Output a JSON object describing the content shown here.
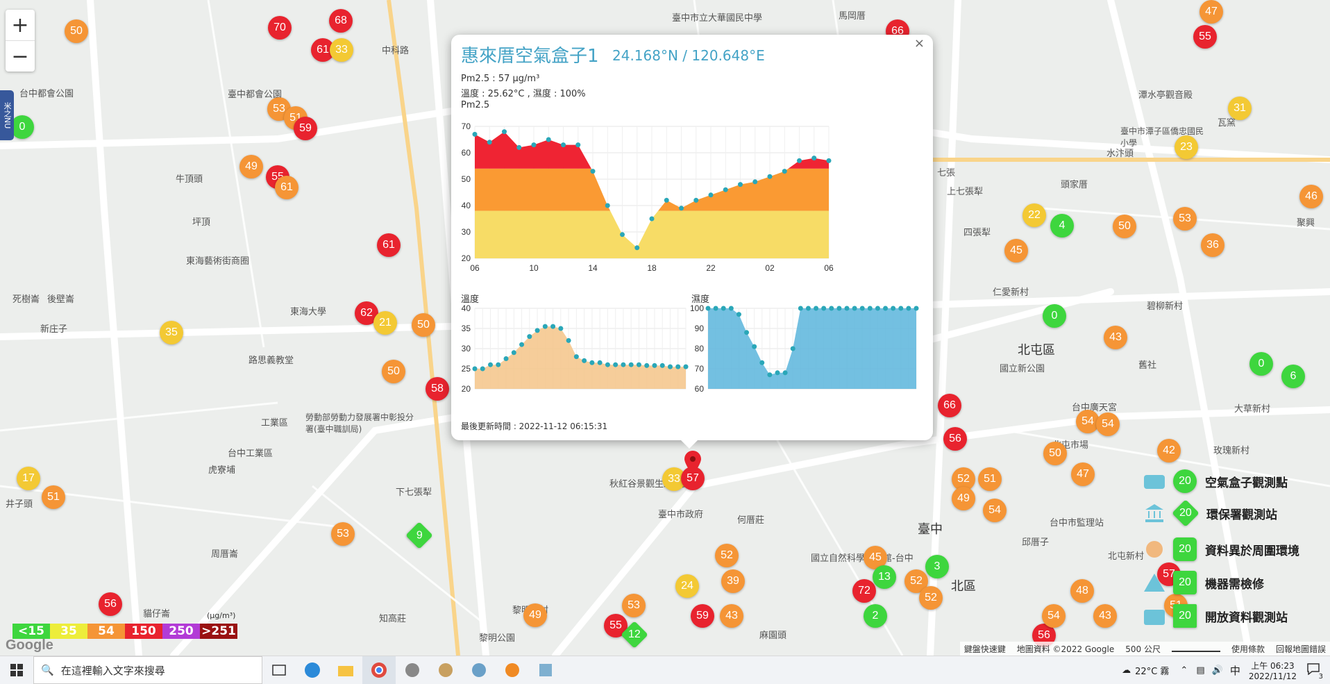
{
  "map": {
    "zoom_in": "+",
    "zoom_out": "−",
    "side_tab": "米之NU",
    "places": [
      "牛頂頭",
      "坪頂",
      "死樹崙",
      "後壁崙",
      "新庄子",
      "臺中都會公園",
      "東海藝術街商圈",
      "東海大學",
      "路思義教堂",
      "勞動部勞動力發展署中彰投分署(臺中職訓局)",
      "工業區",
      "台中工業區",
      "虎寮埔",
      "井子頭",
      "下七張犁",
      "周厝崙",
      "貓仔崙",
      "知高莊",
      "黎明新村",
      "黎明公園",
      "臺中市政府",
      "何厝莊",
      "秋紅谷景觀生態公園",
      "麻園頭",
      "國立自然科學博物館-台中",
      "北區",
      "邱厝子",
      "臺中",
      "北屯區",
      "頭家厝",
      "四張犁",
      "上七張犁",
      "七張",
      "碧柳新村",
      "舊社",
      "大草新村",
      "玫瑰新村",
      "瓦窯",
      "水汴頭",
      "聚興",
      "馬岡厝",
      "臺中市立大華國民中學",
      "臺中市潭子區僑忠國民小學",
      "潭水亭觀音殿",
      "北屯市場",
      "台中廣天宮",
      "台中市監理站",
      "北屯新村",
      "仁愛新村",
      "國立新公園",
      "中科路",
      "台中都會公園"
    ],
    "markers": [
      {
        "v": "50",
        "c": "#f59536"
      },
      {
        "v": "70",
        "c": "#e8232e"
      },
      {
        "v": "68",
        "c": "#e8232e"
      },
      {
        "v": "61",
        "c": "#e8232e"
      },
      {
        "v": "33",
        "c": "#f3c934"
      },
      {
        "v": "53",
        "c": "#f59536"
      },
      {
        "v": "51",
        "c": "#f59536"
      },
      {
        "v": "59",
        "c": "#e8232e"
      },
      {
        "v": "49",
        "c": "#f59536"
      },
      {
        "v": "55",
        "c": "#e8232e"
      },
      {
        "v": "61",
        "c": "#f59536"
      },
      {
        "v": "61",
        "c": "#e8232e"
      },
      {
        "v": "62",
        "c": "#e8232e"
      },
      {
        "v": "21",
        "c": "#f3c934"
      },
      {
        "v": "50",
        "c": "#f59536"
      },
      {
        "v": "35",
        "c": "#f3c934"
      },
      {
        "v": "50",
        "c": "#f59536"
      },
      {
        "v": "58",
        "c": "#e8232e"
      },
      {
        "v": "17",
        "c": "#f3c934"
      },
      {
        "v": "51",
        "c": "#f59536"
      },
      {
        "v": "53",
        "c": "#f59536"
      },
      {
        "v": "9",
        "c": "#3ed63e",
        "shape": "diamond"
      },
      {
        "v": "56",
        "c": "#e8232e"
      },
      {
        "v": "49",
        "c": "#f59536"
      },
      {
        "v": "55",
        "c": "#e8232e"
      },
      {
        "v": "53",
        "c": "#f59536"
      },
      {
        "v": "12",
        "c": "#3ed63e",
        "shape": "diamond"
      },
      {
        "v": "24",
        "c": "#f3c934"
      },
      {
        "v": "59",
        "c": "#e8232e"
      },
      {
        "v": "43",
        "c": "#f59536"
      },
      {
        "v": "52",
        "c": "#f59536"
      },
      {
        "v": "39",
        "c": "#f59536"
      },
      {
        "v": "33",
        "c": "#f3c934"
      },
      {
        "v": "57",
        "c": "#e8232e"
      },
      {
        "v": "45",
        "c": "#f59536"
      },
      {
        "v": "72",
        "c": "#e8232e"
      },
      {
        "v": "13",
        "c": "#3ed63e"
      },
      {
        "v": "3",
        "c": "#3ed63e"
      },
      {
        "v": "52",
        "c": "#f59536"
      },
      {
        "v": "52",
        "c": "#f59536"
      },
      {
        "v": "2",
        "c": "#3ed63e"
      },
      {
        "v": "66",
        "c": "#e8232e"
      },
      {
        "v": "56",
        "c": "#e8232e"
      },
      {
        "v": "52",
        "c": "#f59536"
      },
      {
        "v": "51",
        "c": "#f59536"
      },
      {
        "v": "49",
        "c": "#f59536"
      },
      {
        "v": "54",
        "c": "#f59536"
      },
      {
        "v": "56",
        "c": "#e8232e"
      },
      {
        "v": "66",
        "c": "#e8232e"
      },
      {
        "v": "47",
        "c": "#f59536"
      },
      {
        "v": "55",
        "c": "#e8232e"
      },
      {
        "v": "31",
        "c": "#f3c934"
      },
      {
        "v": "23",
        "c": "#f3c934"
      },
      {
        "v": "46",
        "c": "#f59536"
      },
      {
        "v": "22",
        "c": "#f3c934"
      },
      {
        "v": "4",
        "c": "#3ed63e"
      },
      {
        "v": "50",
        "c": "#f59536"
      },
      {
        "v": "53",
        "c": "#f59536"
      },
      {
        "v": "36",
        "c": "#f59536"
      },
      {
        "v": "45",
        "c": "#f59536"
      },
      {
        "v": "0",
        "c": "#3ed63e"
      },
      {
        "v": "43",
        "c": "#f59536"
      },
      {
        "v": "0",
        "c": "#3ed63e"
      },
      {
        "v": "6",
        "c": "#3ed63e"
      },
      {
        "v": "54",
        "c": "#f59536"
      },
      {
        "v": "54",
        "c": "#f59536"
      },
      {
        "v": "50",
        "c": "#f59536"
      },
      {
        "v": "42",
        "c": "#f59536"
      },
      {
        "v": "47",
        "c": "#f59536"
      },
      {
        "v": "57",
        "c": "#e8232e"
      },
      {
        "v": "48",
        "c": "#f59536"
      },
      {
        "v": "54",
        "c": "#f59536"
      },
      {
        "v": "43",
        "c": "#f59536"
      },
      {
        "v": "51",
        "c": "#f59536"
      },
      {
        "v": "0",
        "c": "#3ed63e"
      }
    ],
    "selected_marker": "57",
    "google_logo": "Google"
  },
  "popup": {
    "close": "×",
    "title": "惠來厝空氣盒子1",
    "coords": "24.168°N / 120.648°E",
    "pm25_line": "Pm2.5 : 57 μg/m³",
    "temp_line": "溫度 : 25.62°C , 濕度 : 100%",
    "chart_label": "Pm2.5",
    "temp_label": "溫度",
    "humid_label": "濕度",
    "updated": "最後更新時間 : 2022-11-12 06:15:31"
  },
  "chart_data": [
    {
      "type": "area",
      "title": "Pm2.5",
      "x": [
        "06",
        "07",
        "08",
        "09",
        "10",
        "11",
        "12",
        "13",
        "14",
        "15",
        "16",
        "17",
        "18",
        "19",
        "20",
        "21",
        "22",
        "23",
        "00",
        "01",
        "02",
        "03",
        "04",
        "05",
        "06"
      ],
      "x_ticks": [
        "06",
        "10",
        "14",
        "18",
        "22",
        "02",
        "06"
      ],
      "values": [
        67,
        64,
        68,
        62,
        63,
        65,
        63,
        63,
        53,
        40,
        29,
        24,
        35,
        42,
        39,
        42,
        44,
        46,
        48,
        49,
        51,
        53,
        57,
        58,
        57
      ],
      "ylim": [
        20,
        70
      ],
      "y_ticks": [
        20,
        30,
        40,
        50,
        60,
        70
      ],
      "bands": [
        {
          "max": 38,
          "color": "#f7dc66"
        },
        {
          "max": 54,
          "color": "#fa9a33"
        },
        {
          "max": 70,
          "color": "#ef2433"
        }
      ]
    },
    {
      "type": "area",
      "title": "溫度",
      "values": [
        25,
        25,
        26,
        26,
        27.5,
        29,
        31,
        33,
        34.5,
        35.5,
        35.5,
        35,
        32,
        28,
        27,
        26.5,
        26.5,
        26,
        26,
        26,
        26,
        26,
        25.8,
        25.8,
        25.8,
        25.5,
        25.5,
        25.5
      ],
      "ylim": [
        20,
        40
      ],
      "y_ticks": [
        20,
        25,
        30,
        35,
        40
      ],
      "color": "#f4c488"
    },
    {
      "type": "area",
      "title": "濕度",
      "values": [
        100,
        100,
        100,
        100,
        97,
        88,
        81,
        73,
        67,
        68,
        68,
        80,
        100,
        100,
        100,
        100,
        100,
        100,
        100,
        100,
        100,
        100,
        100,
        100,
        100,
        100,
        100,
        100
      ],
      "ylim": [
        60,
        100
      ],
      "y_ticks": [
        60,
        70,
        80,
        90,
        100
      ],
      "color": "#5ab5dc"
    }
  ],
  "legend": [
    {
      "value": "20",
      "label": "空氣盒子觀測點"
    },
    {
      "value": "20",
      "label": "環保署觀測站"
    },
    {
      "value": "20",
      "label": "資料異於周圍環境"
    },
    {
      "value": "20",
      "label": "機器需檢修"
    },
    {
      "value": "20",
      "label": "開放資料觀測站"
    }
  ],
  "aqi_scale": {
    "unit": "(μg/m³)",
    "items": [
      {
        "label": "<15",
        "color": "#3ed63e"
      },
      {
        "label": "35",
        "color": "#eded3a"
      },
      {
        "label": "54",
        "color": "#f59536"
      },
      {
        "label": "150",
        "color": "#e8232e"
      },
      {
        "label": "250",
        "color": "#b23bd6"
      },
      {
        "label": ">251",
        "color": "#9a1212"
      }
    ]
  },
  "attribution": {
    "shortcuts": "鍵盤快速鍵",
    "mapdata": "地圖資料 ©2022 Google",
    "scale": "500 公尺",
    "terms": "使用條款",
    "report": "回報地圖錯誤"
  },
  "taskbar": {
    "search_placeholder": "在這裡輸入文字來搜尋",
    "weather": "22°C 霧",
    "ime": "中",
    "time": "上午 06:23",
    "date": "2022/11/12",
    "notif_count": "3"
  }
}
